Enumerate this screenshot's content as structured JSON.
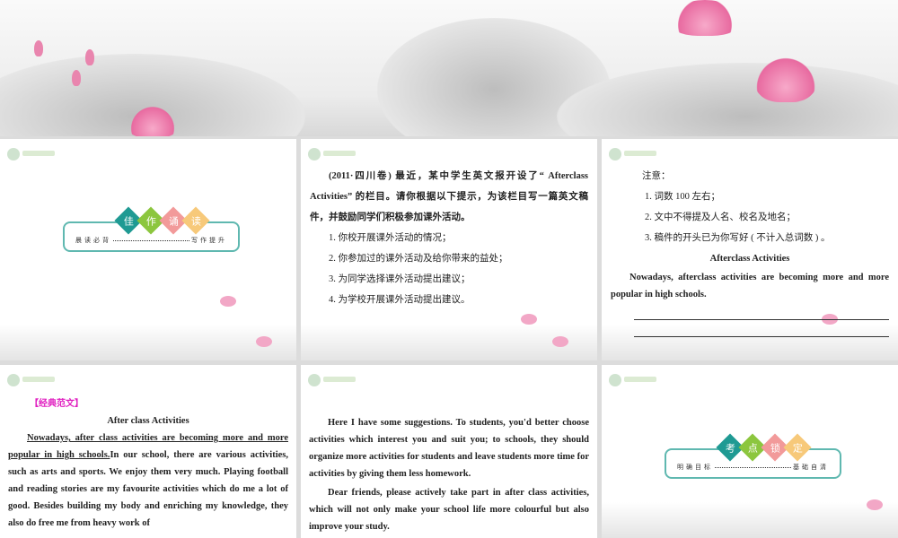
{
  "slides": [
    {
      "title_chars": [
        "佳",
        "作",
        "诵",
        "读"
      ],
      "left": "晨读必背",
      "right": "写作提升"
    },
    {
      "intro": "(2011·四川卷) 最近，某中学生英文报开设了“ Afterclass Activities” 的栏目。请你根据以下提示，为该栏目写一篇英文稿件，并鼓励同学们积极参加课外活动。",
      "items": [
        "1. 你校开展课外活动的情况；",
        "2. 你参加过的课外活动及给你带来的益处；",
        "3. 为同学选择课外活动提出建议；",
        "4. 为学校开展课外活动提出建议。"
      ]
    },
    {
      "note": "注意：",
      "items": [
        "1. 词数 100 左右；",
        "2. 文中不得提及人名、校名及地名；",
        "3. 稿件的开头已为你写好 ( 不计入总词数 ) 。"
      ],
      "heading": "Afterclass Activities",
      "opening": "Nowadays, afterclass activities are becoming more and more popular in high schools."
    },
    {
      "tag": "【经典范文】",
      "heading": "After class Activities",
      "underlined": "Nowadays, after class activities are becoming more and more popular in high schools.",
      "body": "In our school, there are various activities, such as arts and sports. We enjoy them very much. Playing football and reading stories are my favourite activities which do me a lot of good. Besides building my body and enriching my knowledge, they also do free me from heavy work of"
    },
    {
      "p1": "Here I have some suggestions. To students, you'd better choose activities which interest you and suit you; to schools, they should organize more activities for students and leave students more time for activities by giving them less homework.",
      "p2": "Dear friends, please actively take part in after class activities, which will not only make your school life more colourful but also improve your study."
    },
    {
      "title_chars": [
        "考",
        "点",
        "锁",
        "定"
      ],
      "left": "明确目标",
      "right": "基础自清"
    }
  ],
  "colors": {
    "diamonds": [
      "#1f9a93",
      "#8cc63e",
      "#f29a9a",
      "#f7c97a"
    ],
    "frame": "#5fb8b0",
    "tag": "#e020c0"
  }
}
